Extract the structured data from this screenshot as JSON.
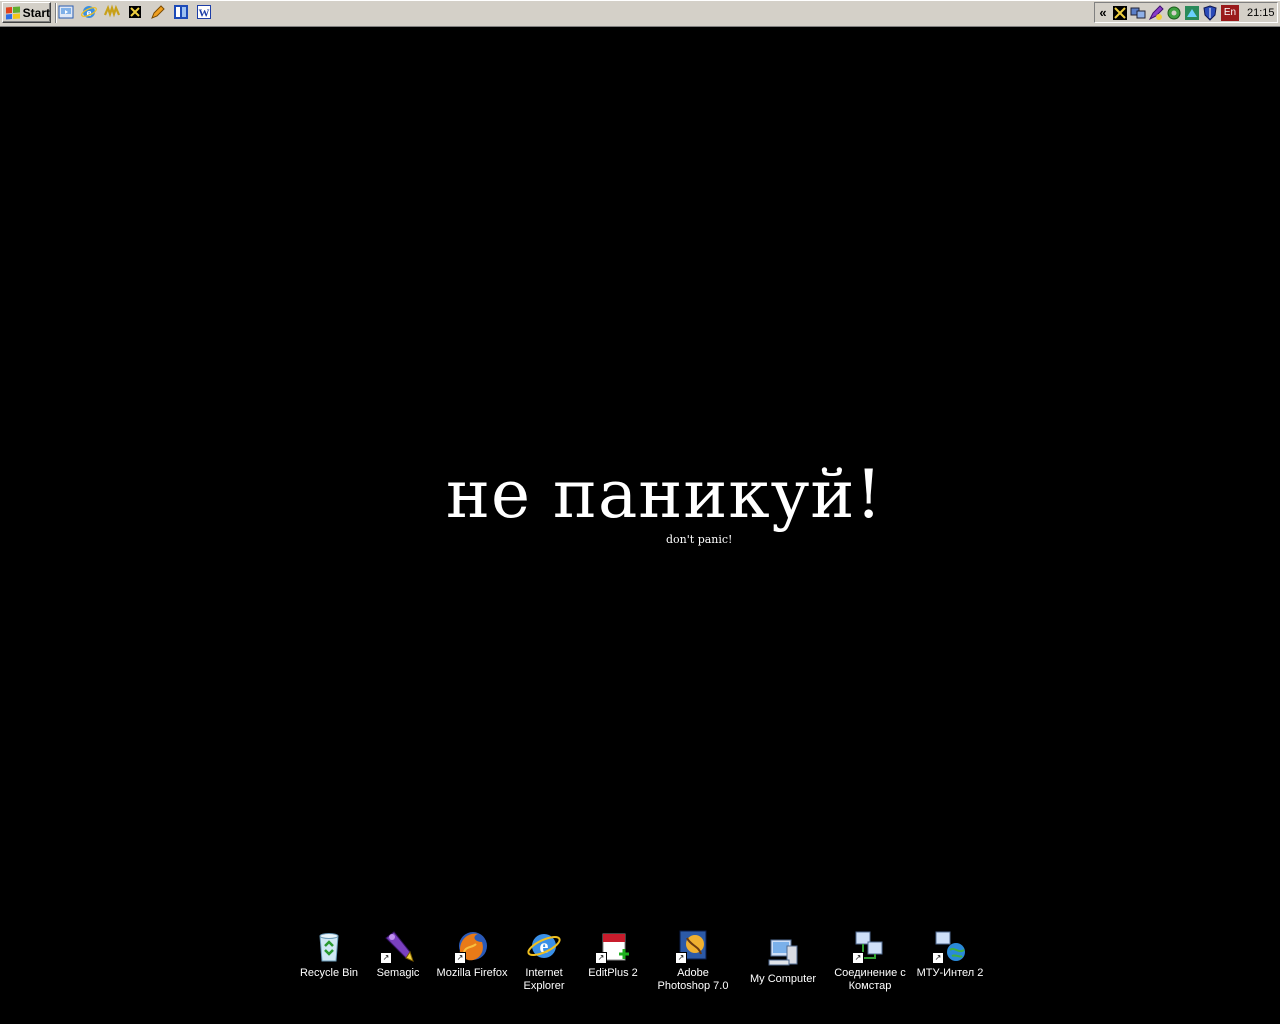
{
  "taskbar": {
    "start_label": "Start",
    "quick_launch": [
      {
        "name": "show-desktop-icon"
      },
      {
        "name": "internet-explorer-icon"
      },
      {
        "name": "winamp-icon"
      },
      {
        "name": "app-icon"
      },
      {
        "name": "pencil-icon"
      },
      {
        "name": "windows-explorer-icon"
      },
      {
        "name": "microsoft-word-icon"
      }
    ],
    "tray": {
      "chevron": "«",
      "language": "En",
      "clock": "21:15"
    }
  },
  "wallpaper": {
    "main_text": "не паникуй!",
    "sub_text": "don't panic!"
  },
  "desktop_icons": [
    {
      "label": "Recycle Bin",
      "icon": "recycle-bin-icon"
    },
    {
      "label": "Semagic",
      "icon": "semagic-icon"
    },
    {
      "label": "Mozilla Firefox",
      "icon": "firefox-icon"
    },
    {
      "label": "Internet\nExplorer",
      "icon": "internet-explorer-icon"
    },
    {
      "label": "EditPlus 2",
      "icon": "editplus-icon"
    },
    {
      "label": "Adobe\nPhotoshop 7.0",
      "icon": "photoshop-icon"
    },
    {
      "label": "My Computer",
      "icon": "my-computer-icon"
    },
    {
      "label": "Соединение с\nКомстар",
      "icon": "network-connection-icon"
    },
    {
      "label": "МТУ-Интел 2",
      "icon": "network-globe-icon"
    }
  ],
  "colors": {
    "desktop_background": "#000000",
    "taskbar": "#d4d0c8",
    "language_badge": "#9a1a1a"
  }
}
